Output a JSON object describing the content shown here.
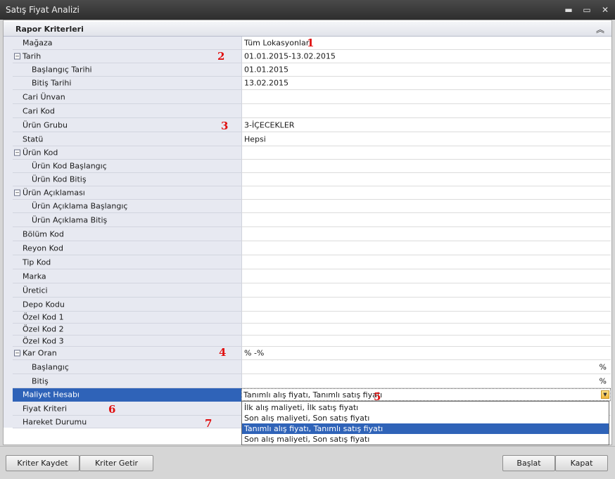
{
  "window": {
    "title": "Satış Fiyat Analizi",
    "minimize": "▬",
    "maximize": "▭",
    "close": "✕"
  },
  "panel": {
    "title": "Rapor Kriterleri",
    "collapse_icon": "«"
  },
  "rows": [
    {
      "label": "Mağaza",
      "value": "Tüm Lokasyonlar",
      "level": 0
    },
    {
      "label": "Tarih",
      "value": "01.01.2015-13.02.2015",
      "level": 0,
      "expander": "−"
    },
    {
      "label": "Başlangıç Tarihi",
      "value": "01.01.2015",
      "level": 1
    },
    {
      "label": "Bitiş Tarihi",
      "value": "13.02.2015",
      "level": 1
    },
    {
      "label": "Cari Ünvan",
      "value": "",
      "level": 0
    },
    {
      "label": "Cari Kod",
      "value": "",
      "level": 0
    },
    {
      "label": "Ürün Grubu",
      "value": "3-İÇECEKLER",
      "level": 0
    },
    {
      "label": "Statü",
      "value": "Hepsi",
      "level": 0
    },
    {
      "label": "Ürün Kod",
      "value": "",
      "level": 0,
      "expander": "−"
    },
    {
      "label": "Ürün Kod Başlangıç",
      "value": "",
      "level": 1
    },
    {
      "label": "Ürün Kod Bitiş",
      "value": "",
      "level": 1
    },
    {
      "label": "Ürün Açıklaması",
      "value": "",
      "level": 0,
      "expander": "−"
    },
    {
      "label": "Ürün Açıklama Başlangıç",
      "value": "",
      "level": 1
    },
    {
      "label": "Ürün Açıklama Bitiş",
      "value": "",
      "level": 1
    },
    {
      "label": "Bölüm Kod",
      "value": "",
      "level": 0
    },
    {
      "label": "Reyon Kod",
      "value": "",
      "level": 0
    },
    {
      "label": "Tip Kod",
      "value": "",
      "level": 0
    },
    {
      "label": "Marka",
      "value": "",
      "level": 0
    },
    {
      "label": "Üretici",
      "value": "",
      "level": 0
    },
    {
      "label": "Depo Kodu",
      "value": "",
      "level": 0
    },
    {
      "label": "Özel Kod 1",
      "value": "",
      "level": 0
    },
    {
      "label": "Özel Kod 2",
      "value": "",
      "level": 0
    },
    {
      "label": "Özel Kod 3",
      "value": "",
      "level": 0
    },
    {
      "label": "Kar Oran",
      "value": "% -%",
      "level": 0,
      "expander": "−"
    },
    {
      "label": "Başlangıç",
      "value": "",
      "level": 1,
      "suffix": "%"
    },
    {
      "label": "Bitiş",
      "value": "",
      "level": 1,
      "suffix": "%"
    },
    {
      "label": "Maliyet Hesabı",
      "value": "",
      "level": 0,
      "selected": true
    },
    {
      "label": "Fiyat Kriteri",
      "value": "",
      "level": 0
    },
    {
      "label": "Hareket Durumu",
      "value": "",
      "level": 0
    }
  ],
  "combo": {
    "value": "Tanımlı alış fiyatı, Tanımlı satış fiyatı",
    "arrow_icon": "▼"
  },
  "dropdown": {
    "options": [
      "İlk alış maliyeti, İlk satış fiyatı",
      "Son alış maliyeti, Son satış fiyatı",
      "Tanımlı alış fiyatı, Tanımlı satış fiyatı",
      "Son alış maliyeti, Son satış fiyatı"
    ],
    "selected_index": 2
  },
  "markers": [
    "1",
    "2",
    "3",
    "4",
    "5",
    "6",
    "7"
  ],
  "buttons": {
    "save": "Kriter Kaydet",
    "load": "Kriter Getir",
    "start": "Başlat",
    "close": "Kapat"
  },
  "colors": {
    "selection": "#2f63b8",
    "marker": "#e01010",
    "label_bg": "#e7e9f1"
  }
}
